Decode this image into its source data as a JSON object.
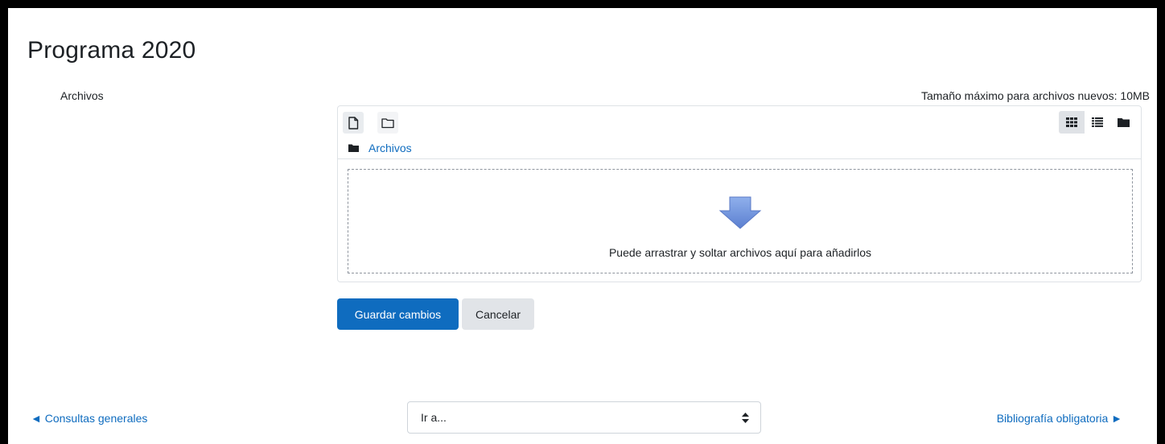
{
  "page": {
    "title": "Programa 2020"
  },
  "form": {
    "field_label": "Archivos",
    "max_size_text": "Tamaño máximo para archivos nuevos: 10MB"
  },
  "filemanager": {
    "toolbar": {
      "add_file_icon": "file-icon",
      "create_folder_icon": "folder-outline-icon",
      "view_modes": [
        "grid-view-icon",
        "list-view-icon",
        "tree-view-icon"
      ],
      "active_view": "grid-view-icon"
    },
    "breadcrumb": {
      "icon": "folder-icon",
      "label": "Archivos"
    },
    "dropzone": {
      "icon": "down-arrow-icon",
      "text": "Puede arrastrar y soltar archivos aquí para añadirlos"
    }
  },
  "actions": {
    "save_label": "Guardar cambios",
    "cancel_label": "Cancelar"
  },
  "navigation": {
    "prev_label": "◄ Consultas generales",
    "jump_label": "Ir a...",
    "next_label": "Bibliografía obligatoria ►"
  },
  "colors": {
    "accent": "#0f6cbf",
    "arrow": "#6e8fd6"
  }
}
